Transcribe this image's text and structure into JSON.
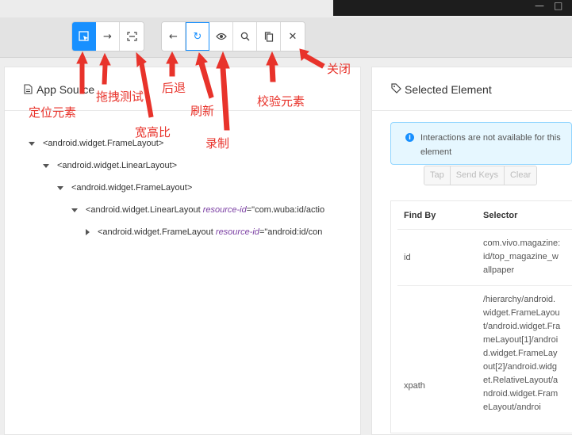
{
  "toolbar": {
    "group1": [
      {
        "name": "select-element-button",
        "glyph": "⬚"
      },
      {
        "name": "swipe-test-button",
        "glyph": "→"
      },
      {
        "name": "aspect-ratio-button",
        "glyph": "⛶"
      }
    ],
    "group2": [
      {
        "name": "back-button",
        "glyph": "←"
      },
      {
        "name": "refresh-button",
        "glyph": "↻"
      },
      {
        "name": "record-button",
        "glyph": "◉"
      },
      {
        "name": "search-button",
        "glyph": "🔍"
      },
      {
        "name": "copy-button",
        "glyph": "❐"
      },
      {
        "name": "close-button",
        "glyph": "✕"
      }
    ]
  },
  "app_source": {
    "title": "App Source",
    "tree": [
      {
        "text": "<android.widget.FrameLayout>",
        "attr": "",
        "rest": ""
      },
      {
        "text": "<android.widget.LinearLayout>",
        "attr": "",
        "rest": ""
      },
      {
        "text": "<android.widget.FrameLayout>",
        "attr": "",
        "rest": ""
      },
      {
        "text": "<android.widget.LinearLayout ",
        "attr": "resource-id",
        "rest": "=\"com.wuba:id/actio"
      },
      {
        "text": "<android.widget.FrameLayout ",
        "attr": "resource-id",
        "rest": "=\"android:id/con"
      }
    ]
  },
  "selected_element": {
    "title": "Selected Element",
    "info": "Interactions are not available for this element",
    "actions": [
      "Tap",
      "Send Keys",
      "Clear"
    ],
    "table": {
      "headers": [
        "Find By",
        "Selector"
      ],
      "rows": [
        {
          "by": "id",
          "selector": "com.vivo.magazine:id/top_magazine_wallpaper"
        },
        {
          "by": "xpath",
          "selector": "/hierarchy/android.widget.FrameLayout/android.widget.FrameLayout[1]/android.widget.FrameLayout[2]/android.widget.RelativeLayout/android.widget.FrameLayout/androi"
        }
      ]
    }
  },
  "annotations": {
    "locate": "定位元素",
    "drag": "拖拽测试",
    "ratio": "宽高比",
    "back": "后退",
    "refresh": "刷新",
    "record": "录制",
    "verify": "校验元素",
    "close": "关闭"
  },
  "colors": {
    "primary": "#1890ff",
    "annotation": "#e8332b"
  }
}
